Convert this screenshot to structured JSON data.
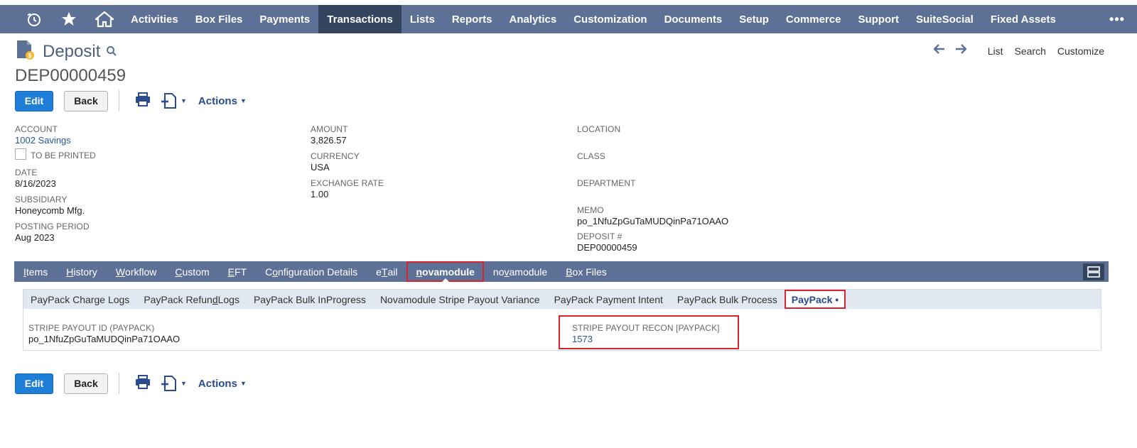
{
  "topnav": {
    "items": [
      "Activities",
      "Box Files",
      "Payments",
      "Transactions",
      "Lists",
      "Reports",
      "Analytics",
      "Customization",
      "Documents",
      "Setup",
      "Commerce",
      "Support",
      "SuiteSocial",
      "Fixed Assets"
    ],
    "active": "Transactions",
    "more": "•••"
  },
  "header": {
    "title": "Deposit",
    "record_id": "DEP00000459",
    "right_links": {
      "list": "List",
      "search": "Search",
      "customize": "Customize"
    }
  },
  "toolbar": {
    "edit": "Edit",
    "back": "Back",
    "actions": "Actions"
  },
  "fields": {
    "account": {
      "label": "ACCOUNT",
      "value": "1002 Savings"
    },
    "to_be_printed": {
      "label": "TO BE PRINTED",
      "checked": false
    },
    "date": {
      "label": "DATE",
      "value": "8/16/2023"
    },
    "subsidiary": {
      "label": "SUBSIDIARY",
      "value": "Honeycomb Mfg."
    },
    "posting_period": {
      "label": "POSTING PERIOD",
      "value": "Aug 2023"
    },
    "amount": {
      "label": "AMOUNT",
      "value": "3,826.57"
    },
    "currency": {
      "label": "CURRENCY",
      "value": "USA"
    },
    "exchange_rate": {
      "label": "EXCHANGE RATE",
      "value": "1.00"
    },
    "location": {
      "label": "LOCATION",
      "value": ""
    },
    "class": {
      "label": "CLASS",
      "value": ""
    },
    "department": {
      "label": "DEPARTMENT",
      "value": ""
    },
    "memo": {
      "label": "MEMO",
      "value": "po_1NfuZpGuTaMUDQinPa71OAAO"
    },
    "deposit_no": {
      "label": "DEPOSIT #",
      "value": "DEP00000459"
    }
  },
  "tabs": {
    "items": [
      {
        "pre": "",
        "ul": "I",
        "post": "tems"
      },
      {
        "pre": "",
        "ul": "H",
        "post": "istory"
      },
      {
        "pre": "",
        "ul": "W",
        "post": "orkflow"
      },
      {
        "pre": "",
        "ul": "C",
        "post": "ustom"
      },
      {
        "pre": "",
        "ul": "E",
        "post": "FT"
      },
      {
        "pre": "C",
        "ul": "o",
        "post": "nfiguration Details"
      },
      {
        "pre": "e",
        "ul": "T",
        "post": "ail"
      },
      {
        "pre": "",
        "ul": "n",
        "post": "ovamodule"
      },
      {
        "pre": "no",
        "ul": "v",
        "post": "amodule"
      },
      {
        "pre": "",
        "ul": "B",
        "post": "ox Files"
      }
    ],
    "active_index": 7
  },
  "subtabs": {
    "items": [
      {
        "pre": "PayPack Charge Logs",
        "ul": "",
        "post": ""
      },
      {
        "pre": "PayPack Refun",
        "ul": "d",
        "post": " Logs"
      },
      {
        "pre": "PayPack Bulk InProgress",
        "ul": "",
        "post": ""
      },
      {
        "pre": "Novamodule Stripe Payout Variance",
        "ul": "",
        "post": ""
      },
      {
        "pre": "PayPack Payment Intent",
        "ul": "",
        "post": ""
      },
      {
        "pre": "PayPack Bulk Process",
        "ul": "",
        "post": ""
      },
      {
        "pre": "PayPack •",
        "ul": "",
        "post": ""
      }
    ],
    "active_index": 6
  },
  "paypack": {
    "stripe_payout_id": {
      "label": "STRIPE PAYOUT ID (PAYPACK)",
      "value": "po_1NfuZpGuTaMUDQinPa71OAAO"
    },
    "stripe_payout_recon": {
      "label": "STRIPE PAYOUT RECON [PAYPACK]",
      "value": "1573"
    }
  },
  "colors": {
    "nav": "#5d7196",
    "nav_active": "#33445e",
    "accent_blue": "#1f7ed8",
    "highlight_red": "#d9232e"
  }
}
